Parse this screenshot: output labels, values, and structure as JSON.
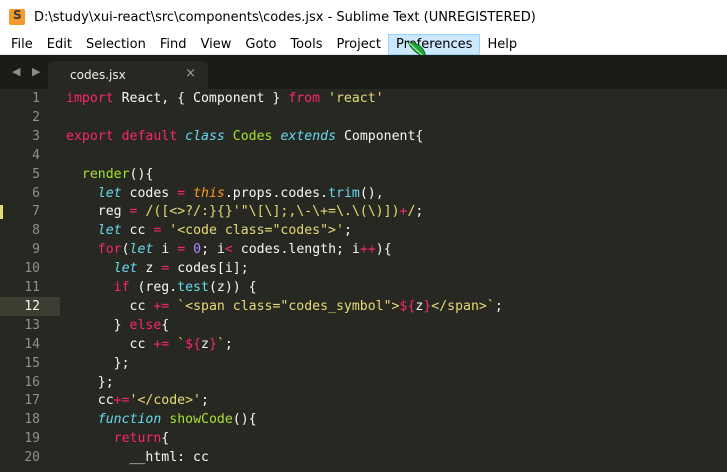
{
  "window": {
    "title": "D:\\study\\xui-react\\src\\components\\codes.jsx - Sublime Text (UNREGISTERED)",
    "icon": "sublime-text-icon"
  },
  "menu": [
    "File",
    "Edit",
    "Selection",
    "Find",
    "View",
    "Goto",
    "Tools",
    "Project",
    "Preferences",
    "Help"
  ],
  "tabs": {
    "nav": "◀ ▶",
    "active_tab": "codes.jsx",
    "close": "×"
  },
  "editor": {
    "current_line": 12,
    "modified_lines": [
      7
    ],
    "colors": {
      "keyword": "#f92672",
      "string": "#e6db74",
      "type": "#66d9ef",
      "class_name": "#a6e22e",
      "number": "#ae81ff",
      "this": "#fd971f",
      "background": "#272822"
    },
    "lines": [
      [
        [
          "kw",
          "import"
        ],
        [
          "pl",
          " React, { Component } "
        ],
        [
          "kw",
          "from"
        ],
        [
          "pl",
          " "
        ],
        [
          "st",
          "'react'"
        ]
      ],
      [],
      [
        [
          "kw",
          "export"
        ],
        [
          "pl",
          " "
        ],
        [
          "kw",
          "default"
        ],
        [
          "pl",
          " "
        ],
        [
          "ty",
          "class"
        ],
        [
          "pl",
          " "
        ],
        [
          "cn",
          "Codes"
        ],
        [
          "pl",
          " "
        ],
        [
          "ty",
          "extends"
        ],
        [
          "pl",
          " Component{"
        ]
      ],
      [],
      [
        [
          "pl",
          "  "
        ],
        [
          "fn",
          "render"
        ],
        [
          "pl",
          "(){"
        ]
      ],
      [
        [
          "pl",
          "    "
        ],
        [
          "ty",
          "let"
        ],
        [
          "pl",
          " codes "
        ],
        [
          "kw",
          "="
        ],
        [
          "pl",
          " "
        ],
        [
          "th",
          "this"
        ],
        [
          "pl",
          ".props.codes."
        ],
        [
          "sp",
          "trim"
        ],
        [
          "pl",
          "(),"
        ]
      ],
      [
        [
          "pl",
          "    reg "
        ],
        [
          "kw",
          "="
        ],
        [
          "pl",
          " "
        ],
        [
          "st",
          "/([<>?/:}{}'\"\\[\\];,\\-\\+=\\.\\(\\)])"
        ],
        [
          "kw",
          "+"
        ],
        [
          "st",
          "/"
        ],
        [
          "pl",
          ";"
        ]
      ],
      [
        [
          "pl",
          "    "
        ],
        [
          "ty",
          "let"
        ],
        [
          "pl",
          " cc "
        ],
        [
          "kw",
          "="
        ],
        [
          "pl",
          " "
        ],
        [
          "st",
          "'<code class=\"codes\">'"
        ],
        [
          "pl",
          ";"
        ]
      ],
      [
        [
          "pl",
          "    "
        ],
        [
          "kw",
          "for"
        ],
        [
          "pl",
          "("
        ],
        [
          "ty",
          "let"
        ],
        [
          "pl",
          " i "
        ],
        [
          "kw",
          "="
        ],
        [
          "pl",
          " "
        ],
        [
          "nm",
          "0"
        ],
        [
          "pl",
          "; i"
        ],
        [
          "kw",
          "<"
        ],
        [
          "pl",
          " codes.length; i"
        ],
        [
          "kw",
          "++"
        ],
        [
          "pl",
          "){"
        ]
      ],
      [
        [
          "pl",
          "      "
        ],
        [
          "ty",
          "let"
        ],
        [
          "pl",
          " z "
        ],
        [
          "kw",
          "="
        ],
        [
          "pl",
          " codes[i];"
        ]
      ],
      [
        [
          "pl",
          "      "
        ],
        [
          "kw",
          "if"
        ],
        [
          "pl",
          " (reg."
        ],
        [
          "sp",
          "test"
        ],
        [
          "pl",
          "(z)) {"
        ]
      ],
      [
        [
          "pl",
          "        cc "
        ],
        [
          "kw",
          "+="
        ],
        [
          "pl",
          " "
        ],
        [
          "st",
          "`<span class=\"codes_symbol\">"
        ],
        [
          "kw",
          "${"
        ],
        [
          "pl",
          "z"
        ],
        [
          "kw",
          "}"
        ],
        [
          "st",
          "</span>`"
        ],
        [
          "pl",
          ";"
        ]
      ],
      [
        [
          "pl",
          "      } "
        ],
        [
          "kw",
          "else"
        ],
        [
          "pl",
          "{"
        ]
      ],
      [
        [
          "pl",
          "        cc "
        ],
        [
          "kw",
          "+="
        ],
        [
          "pl",
          " "
        ],
        [
          "st",
          "`"
        ],
        [
          "kw",
          "${"
        ],
        [
          "pl",
          "z"
        ],
        [
          "kw",
          "}"
        ],
        [
          "st",
          "`"
        ],
        [
          "pl",
          ";"
        ]
      ],
      [
        [
          "pl",
          "      };"
        ]
      ],
      [
        [
          "pl",
          "    };"
        ]
      ],
      [
        [
          "pl",
          "    cc"
        ],
        [
          "kw",
          "+="
        ],
        [
          "st",
          "'</code>'"
        ],
        [
          "pl",
          ";"
        ]
      ],
      [
        [
          "pl",
          "    "
        ],
        [
          "ty",
          "function"
        ],
        [
          "pl",
          " "
        ],
        [
          "fn",
          "showCode"
        ],
        [
          "pl",
          "(){"
        ]
      ],
      [
        [
          "pl",
          "      "
        ],
        [
          "kw",
          "return"
        ],
        [
          "pl",
          "{"
        ]
      ],
      [
        [
          "pl",
          "        __html: cc"
        ]
      ]
    ]
  }
}
